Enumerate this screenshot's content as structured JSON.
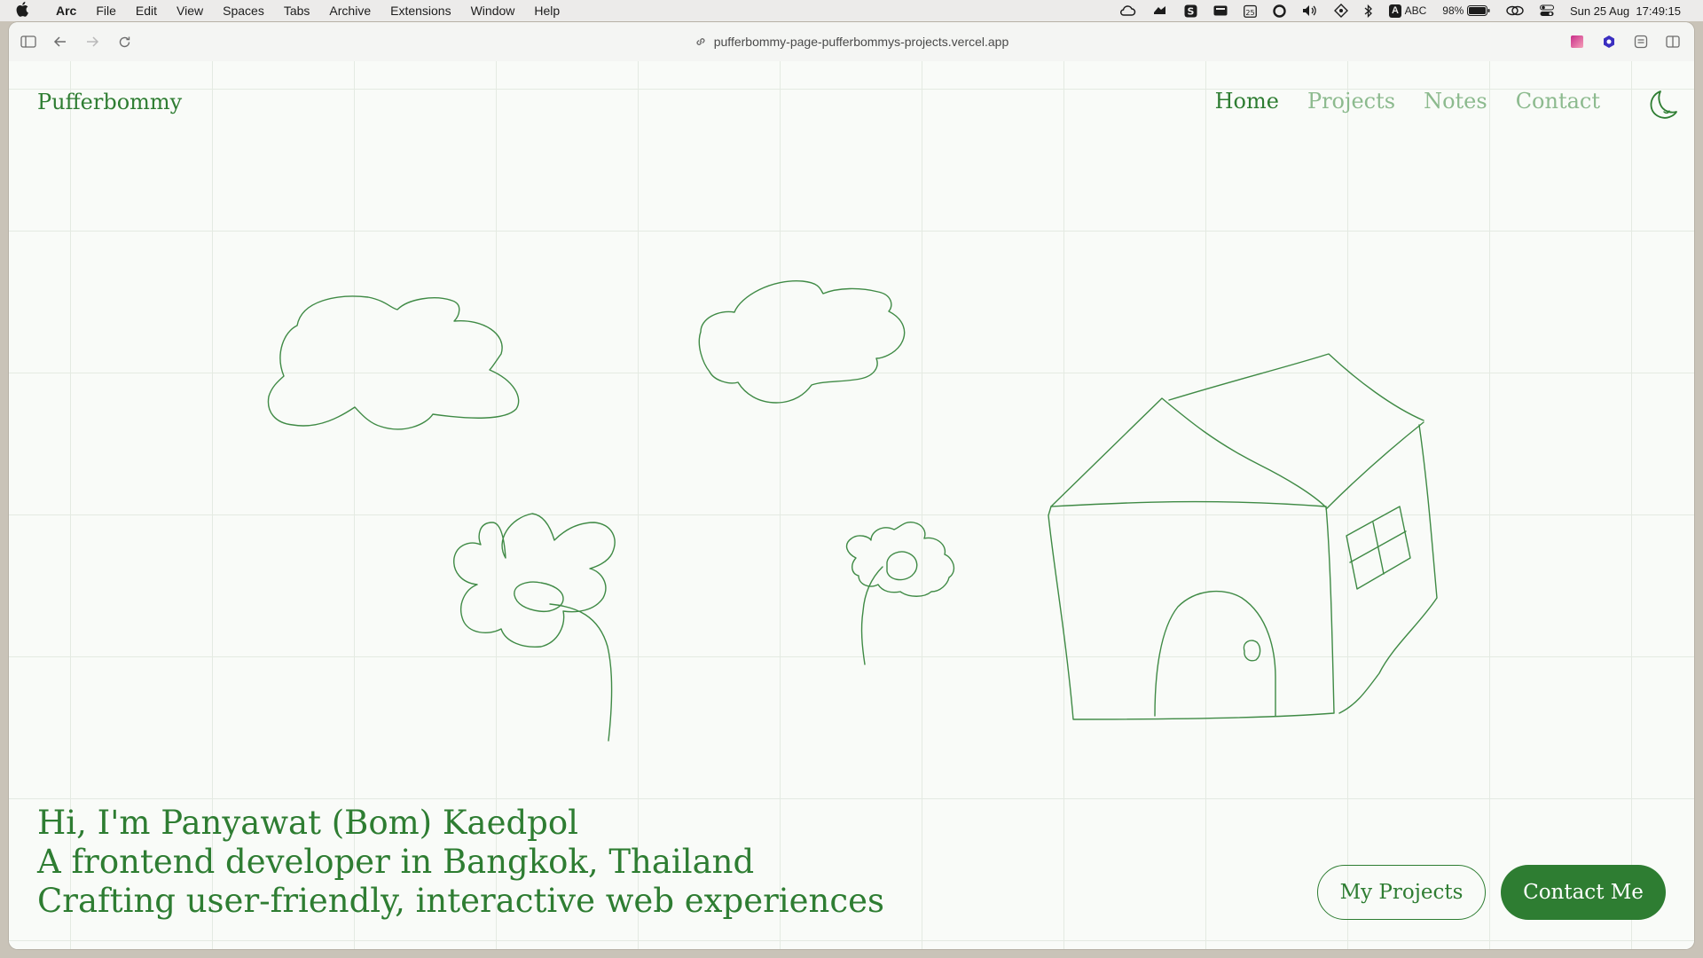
{
  "menubar": {
    "app": "Arc",
    "items": [
      "File",
      "Edit",
      "View",
      "Spaces",
      "Tabs",
      "Archive",
      "Extensions",
      "Window",
      "Help"
    ],
    "input_source_badge": "A",
    "input_source": "ABC",
    "battery": "98%",
    "datetime": "Sun 25 Aug  17:49:15"
  },
  "browser": {
    "url": "pufferbommy-page-pufferbommys-projects.vercel.app"
  },
  "site": {
    "logo": "Pufferbommy",
    "nav": [
      "Home",
      "Projects",
      "Notes",
      "Contact"
    ],
    "active_nav": "Home",
    "hero_lines": [
      "Hi, I'm Panyawat (Bom) Kaedpol",
      "A frontend developer in Bangkok, Thailand",
      "Crafting user-friendly, interactive web experiences"
    ],
    "buttons": {
      "projects": "My Projects",
      "contact": "Contact Me"
    },
    "drawing_items": [
      "cloud-1",
      "cloud-2",
      "flower-1",
      "flower-2",
      "house"
    ]
  },
  "colors": {
    "accent": "#2e7d32",
    "accent_muted": "#8cba8e",
    "background": "#f9fbf8",
    "grid": "#e4eae2"
  }
}
